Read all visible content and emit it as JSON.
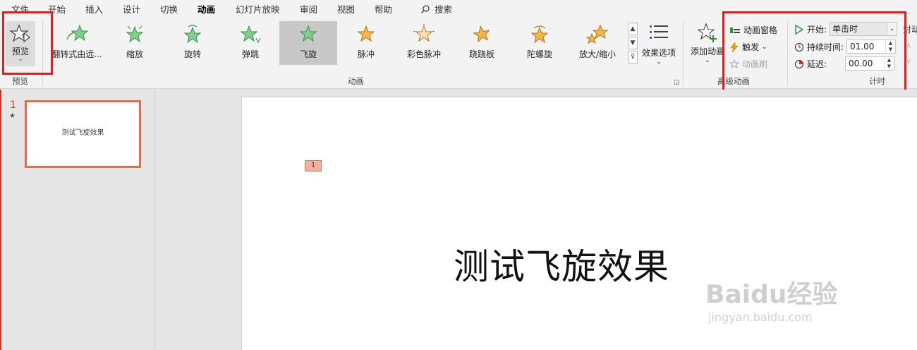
{
  "menu": {
    "tabs": [
      "文件",
      "开始",
      "插入",
      "设计",
      "切换",
      "动画",
      "幻灯片放映",
      "审阅",
      "视图",
      "帮助"
    ],
    "active_tab": "动画",
    "search_label": "搜索"
  },
  "ribbon": {
    "preview": {
      "label": "预览",
      "group_label": "预览"
    },
    "animation_gallery": {
      "items": [
        "翻转式由远...",
        "缩放",
        "旋转",
        "弹跳",
        "飞旋",
        "脉冲",
        "彩色脉冲",
        "跷跷板",
        "陀螺旋",
        "放大/缩小"
      ],
      "selected": "飞旋",
      "group_label": "动画"
    },
    "effect_options_label": "效果选项",
    "advanced": {
      "add_animation_label": "添加动画",
      "animation_pane_label": "动画窗格",
      "trigger_label": "触发",
      "animation_painter_label": "动画刷",
      "group_label": "高级动画"
    },
    "timing": {
      "start_label": "开始:",
      "start_value": "单击时",
      "duration_label": "持续时间:",
      "duration_value": "01.00",
      "delay_label": "延迟:",
      "delay_value": "00.00",
      "group_label": "计时",
      "reorder_label": "对动"
    }
  },
  "slides_pane": {
    "slide_number": "1",
    "thumbnail_text": "测试飞旋效果"
  },
  "slide": {
    "animation_tag": "1",
    "title": "测试飞旋效果"
  },
  "watermark": {
    "logo": "Baidu经验",
    "url": "jingyan.baidu.com"
  },
  "colors": {
    "accent": "#c43e1c",
    "highlight_box": "#e41e1e",
    "green_star": "#7ed08a",
    "orange_star": "#f6b64a"
  }
}
